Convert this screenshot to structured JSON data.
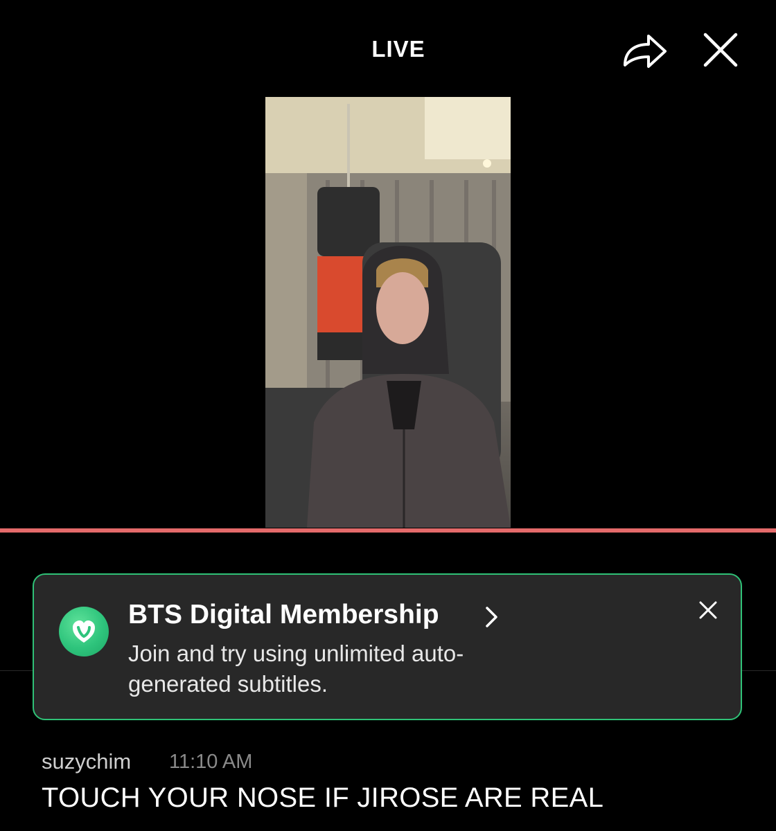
{
  "header": {
    "title": "LIVE",
    "share_icon": "share-arrow-icon",
    "close_icon": "close-icon"
  },
  "video": {
    "description_icon": "live-video-frame",
    "progress": 1.0
  },
  "membership_banner": {
    "logo_icon": "weverse-heart-logo-icon",
    "title": "BTS Digital Membership",
    "chevron_icon": "chevron-right-icon",
    "text": "Join and try using unlimited auto-generated subtitles.",
    "close_icon": "close-icon",
    "accent_color": "#2fc277"
  },
  "chat": {
    "username": "suzychim",
    "timestamp": "11:10 AM",
    "message": "TOUCH YOUR NOSE IF JIROSE ARE REAL"
  },
  "colors": {
    "background": "#000000",
    "progress": "#e46a6a",
    "banner_bg": "#282828"
  }
}
